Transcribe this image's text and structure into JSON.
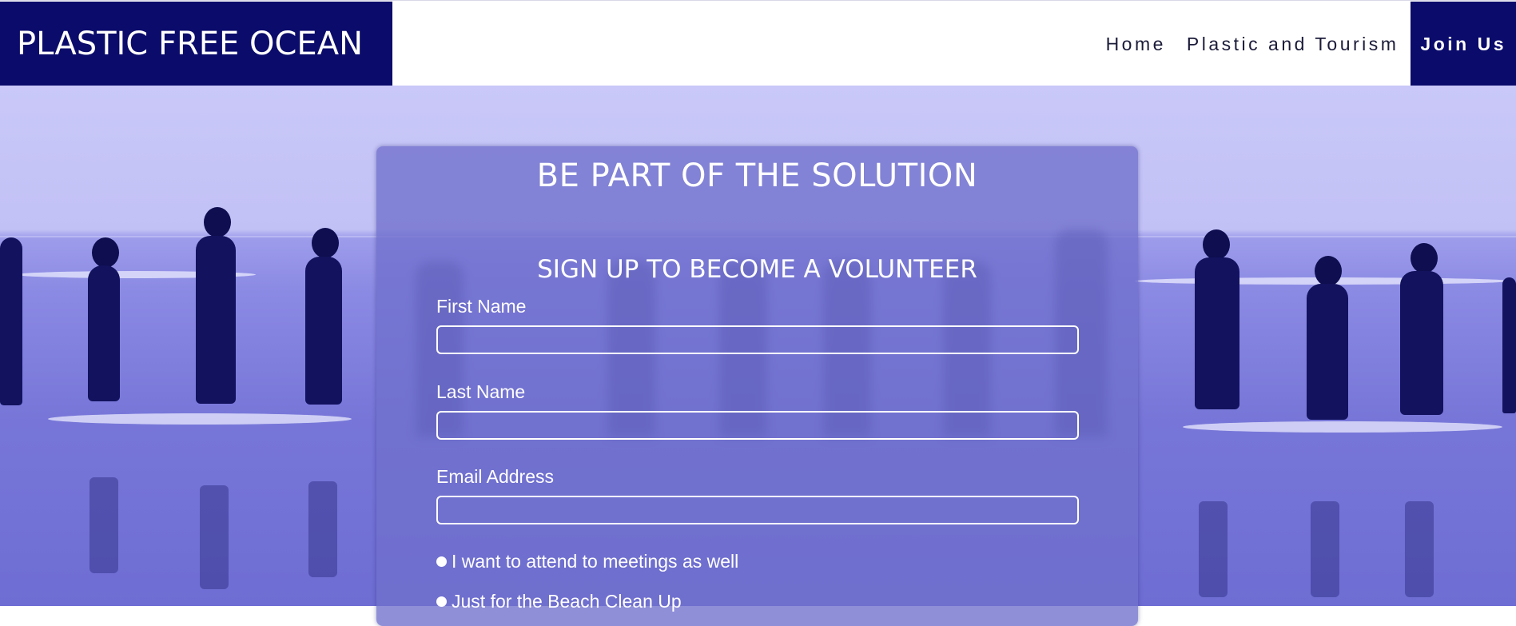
{
  "header": {
    "brand": "PLASTIC FREE OCEAN",
    "nav": [
      {
        "label": "Home"
      },
      {
        "label": "Plastic and Tourism"
      },
      {
        "label": "Join Us"
      }
    ]
  },
  "form": {
    "title": "BE PART OF THE SOLUTION",
    "subtitle": "SIGN UP TO BECOME A VOLUNTEER",
    "fields": [
      {
        "label": "First Name",
        "value": ""
      },
      {
        "label": "Last Name",
        "value": ""
      },
      {
        "label": "Email Address",
        "value": ""
      }
    ],
    "options": [
      {
        "label": "I want to attend to meetings as well"
      },
      {
        "label": "Just for the Beach Clean Up"
      }
    ]
  },
  "colors": {
    "brand": "#0b0b6b",
    "hero_tint": "#7776d8"
  }
}
